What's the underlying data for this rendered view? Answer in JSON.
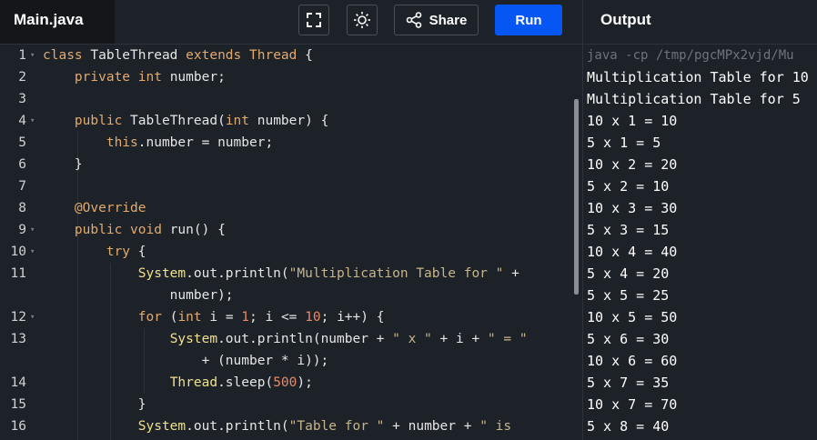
{
  "header": {
    "file_tab": "Main.java",
    "share_label": "Share",
    "run_label": "Run",
    "output_title": "Output",
    "icons": [
      "fullscreen-icon",
      "theme-icon",
      "share-icon"
    ]
  },
  "editor": {
    "lines": [
      {
        "num": "1",
        "fold": "▾",
        "html": "<span class='kw'>class</span> TableThread <span class='kw'>extends</span> <span class='ty'>Thread</span> {"
      },
      {
        "num": "2",
        "fold": "",
        "html": "    <span class='kw'>private</span> <span class='kw'>int</span> number;"
      },
      {
        "num": "3",
        "fold": "",
        "html": ""
      },
      {
        "num": "4",
        "fold": "▾",
        "html": "    <span class='kw'>public</span> TableThread(<span class='kw'>int</span> number) {"
      },
      {
        "num": "5",
        "fold": "",
        "html": "        <span class='kw'>this</span>.number = number;"
      },
      {
        "num": "6",
        "fold": "",
        "html": "    }"
      },
      {
        "num": "7",
        "fold": "",
        "html": ""
      },
      {
        "num": "8",
        "fold": "",
        "html": "    <span class='kw'>@Override</span>"
      },
      {
        "num": "9",
        "fold": "▾",
        "html": "    <span class='kw'>public</span> <span class='kw'>void</span> run() {"
      },
      {
        "num": "10",
        "fold": "▾",
        "html": "        <span class='kw'>try</span> {"
      },
      {
        "num": "11",
        "fold": "",
        "html": "            <span class='fn'>System</span>.out.println(<span class='str'>\"Multiplication Table for \"</span> +"
      },
      {
        "num": "",
        "fold": "",
        "html": "                number);"
      },
      {
        "num": "12",
        "fold": "▾",
        "html": "            <span class='kw'>for</span> (<span class='kw'>int</span> i = <span class='num'>1</span>; i &lt;= <span class='num'>10</span>; i++) {"
      },
      {
        "num": "13",
        "fold": "",
        "html": "                <span class='fn'>System</span>.out.println(number + <span class='str'>\" x \"</span> + i + <span class='str'>\" = \"</span>"
      },
      {
        "num": "",
        "fold": "",
        "html": "                    + (number * i));"
      },
      {
        "num": "14",
        "fold": "",
        "html": "                <span class='fn'>Thread</span>.sleep(<span class='num'>500</span>);"
      },
      {
        "num": "15",
        "fold": "",
        "html": "            }"
      },
      {
        "num": "16",
        "fold": "",
        "html": "            <span class='fn'>System</span>.out.println(<span class='str'>\"Table for \"</span> + number + <span class='str'>\" is</span>"
      }
    ]
  },
  "output": {
    "command": "java -cp /tmp/pgcMPx2vjd/Mu",
    "lines": [
      "Multiplication Table for 10",
      "Multiplication Table for 5",
      "10 x 1 = 10",
      "5 x 1 = 5",
      "10 x 2 = 20",
      "5 x 2 = 10",
      "10 x 3 = 30",
      "5 x 3 = 15",
      "10 x 4 = 40",
      "5 x 4 = 20",
      "5 x 5 = 25",
      "10 x 5 = 50",
      "5 x 6 = 30",
      "10 x 6 = 60",
      "5 x 7 = 35",
      "10 x 7 = 70",
      "5 x 8 = 40"
    ]
  },
  "colors": {
    "background": "#1d2128",
    "run_button": "#0556f3",
    "keyword": "#e2aa6e",
    "string": "#c7b58a",
    "number": "#e58a6a"
  }
}
